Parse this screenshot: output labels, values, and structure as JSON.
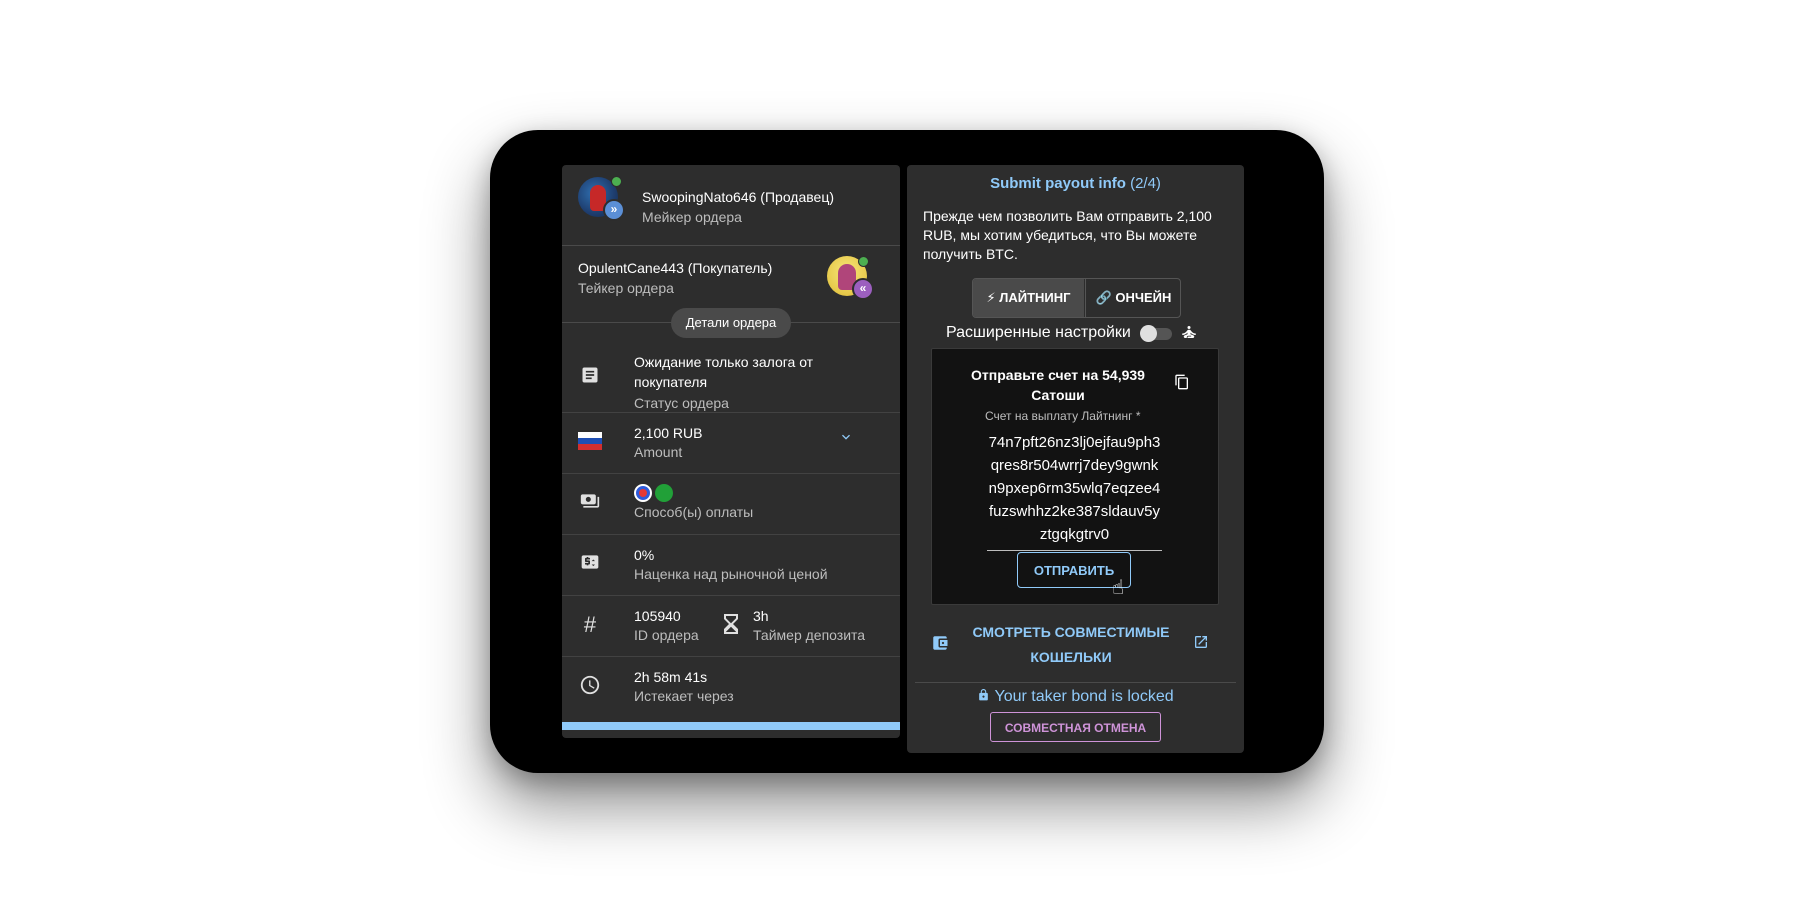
{
  "seller": {
    "name": "SwoopingNato646 (Продавец)",
    "role": "Мейкер ордера",
    "badge": "»"
  },
  "buyer": {
    "name": "OpulentCane443 (Покупатель)",
    "role": "Тейкер ордера",
    "badge": "«"
  },
  "details_chip": "Детали ордера",
  "order": {
    "status": {
      "value": "Ожидание только залога от покупателя",
      "label": "Статус ордера",
      "icon": "article-icon"
    },
    "amount": {
      "value": "2,100 RUB",
      "label": "Amount",
      "flag_colors": [
        "#ffffff",
        "#1f4fb4",
        "#d32f2f"
      ]
    },
    "payment": {
      "label": "Способ(ы) оплаты",
      "methods": [
        "bank-logo-icon",
        "green-bank-logo-icon"
      ]
    },
    "premium": {
      "value": "0%",
      "label": "Наценка над рыночной ценой"
    },
    "id": {
      "value": "105940",
      "label": "ID ордера"
    },
    "deposit_timer": {
      "value": "3h",
      "label": "Таймер депозита"
    },
    "expires": {
      "value": "2h 58m 41s",
      "label": "Истекает через"
    }
  },
  "payout": {
    "title": "Submit payout info",
    "step": "(2/4)",
    "intro": "Прежде чем позволить Вам отправить 2,100 RUB, мы хотим убедиться, что Вы можете получить BTC.",
    "tabs": {
      "lightning": "ЛАЙТНИНГ",
      "onchain": "ОНЧЕЙН"
    },
    "advanced_label": "Расширенные настройки",
    "invoice": {
      "send_label": "Отправьте счет на 54,939 Сатоши",
      "field_label": "Счет на выплату Лайтнинг *",
      "value": "74n7pft26nz3lj0ejfau9ph3qres8r504wrrj7dey9gwnkn9pxep6rm35wlq7eqzee4fuzswhhz2ke387sldauv5yztgqkgtrv0",
      "submit": "ОТПРАВИТЬ"
    },
    "wallets_link": "СМОТРЕТЬ СОВМЕСТИМЫЕ КОШЕЛЬКИ",
    "bond_status": "Your taker bond is locked",
    "cancel_button": "СОВМЕСТНАЯ ОТМЕНА"
  },
  "colors": {
    "accent": "#90caf9",
    "secondary_accent": "#ce93d8",
    "progress": "#90caf9"
  }
}
